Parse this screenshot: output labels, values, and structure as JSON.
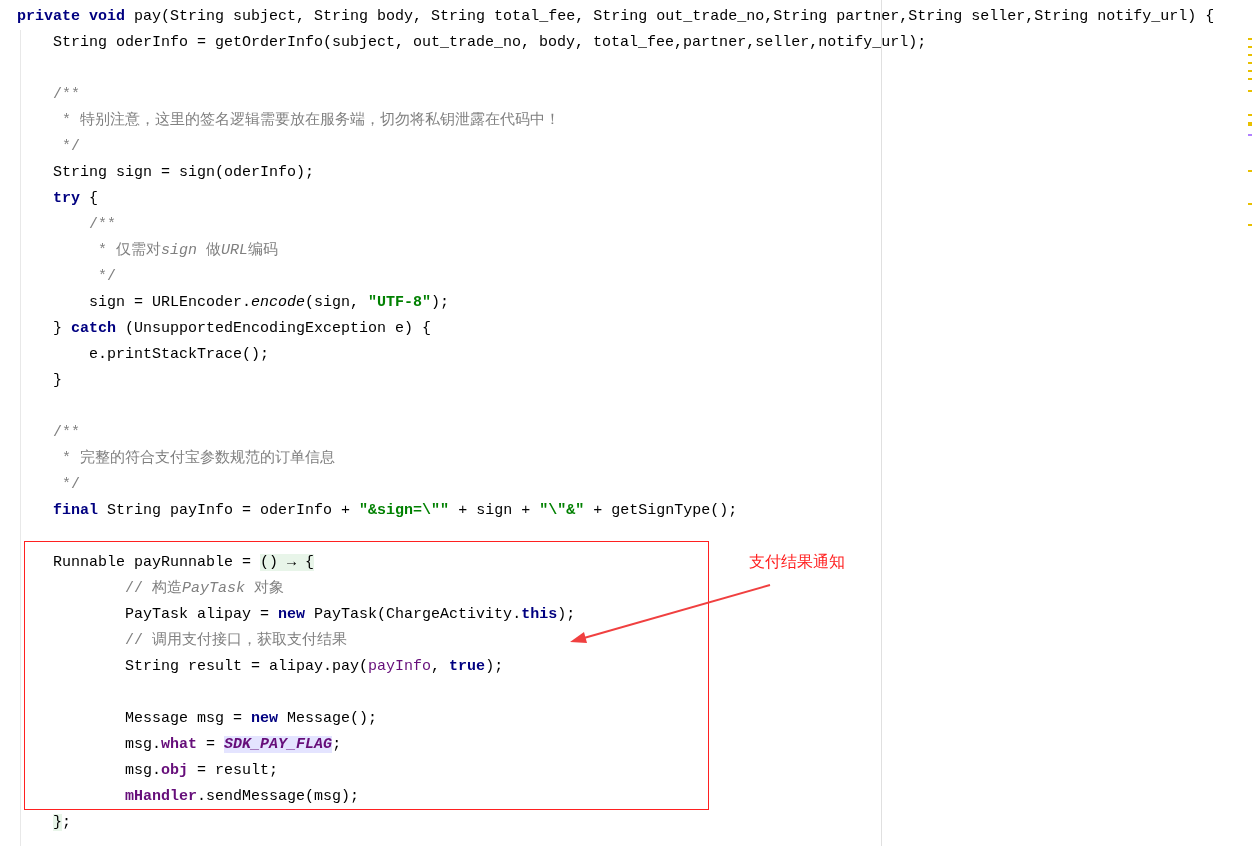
{
  "code_lines": [
    {
      "kind": "code",
      "tokens": [
        {
          "text": "private",
          "kind": "keyword"
        },
        {
          "text": " void",
          "kind": "keyword"
        },
        {
          "text": " pay(String subject, String body, String total_fee, String out_trade_no,String partner,String seller,String notify_url) {",
          "kind": "plain"
        }
      ]
    },
    {
      "kind": "code",
      "tokens": [
        {
          "text": "    String oderInfo = getOrderInfo(subject, out_trade_no, body, total_fee,partner,seller,notify_url);",
          "kind": "plain"
        }
      ]
    },
    {
      "kind": "blank"
    },
    {
      "kind": "code",
      "tokens": [
        {
          "text": "    /**",
          "kind": "comment"
        }
      ]
    },
    {
      "kind": "code",
      "tokens": [
        {
          "text": "     * 特别注意，这里的签名逻辑需要放在服务端，切勿将私钥泄露在代码中！",
          "kind": "comment"
        }
      ]
    },
    {
      "kind": "code",
      "tokens": [
        {
          "text": "     */",
          "kind": "comment"
        }
      ]
    },
    {
      "kind": "code",
      "tokens": [
        {
          "text": "    String sign = sign(oderInfo);",
          "kind": "plain"
        }
      ]
    },
    {
      "kind": "code",
      "tokens": [
        {
          "text": "    try",
          "kind": "keyword"
        },
        {
          "text": " {",
          "kind": "plain"
        }
      ]
    },
    {
      "kind": "code",
      "tokens": [
        {
          "text": "        /**",
          "kind": "comment"
        }
      ]
    },
    {
      "kind": "code",
      "tokens": [
        {
          "text": "         * 仅需对",
          "kind": "comment"
        },
        {
          "text": "sign",
          "kind": "comment_italic"
        },
        {
          "text": " 做",
          "kind": "comment"
        },
        {
          "text": "URL",
          "kind": "comment_italic"
        },
        {
          "text": "编码",
          "kind": "comment"
        }
      ]
    },
    {
      "kind": "code",
      "tokens": [
        {
          "text": "         */",
          "kind": "comment"
        }
      ]
    },
    {
      "kind": "code",
      "tokens": [
        {
          "text": "        sign = URLEncoder.",
          "kind": "plain"
        },
        {
          "text": "encode",
          "kind": "italic"
        },
        {
          "text": "(sign, ",
          "kind": "plain"
        },
        {
          "text": "\"UTF-8\"",
          "kind": "string"
        },
        {
          "text": ");",
          "kind": "plain"
        }
      ]
    },
    {
      "kind": "code",
      "tokens": [
        {
          "text": "    } ",
          "kind": "plain"
        },
        {
          "text": "catch",
          "kind": "keyword"
        },
        {
          "text": " (UnsupportedEncodingException e) {",
          "kind": "plain"
        }
      ]
    },
    {
      "kind": "code",
      "tokens": [
        {
          "text": "        e.printStackTrace();",
          "kind": "plain"
        }
      ]
    },
    {
      "kind": "code",
      "tokens": [
        {
          "text": "    }",
          "kind": "plain"
        }
      ]
    },
    {
      "kind": "blank"
    },
    {
      "kind": "code",
      "tokens": [
        {
          "text": "    /**",
          "kind": "comment"
        }
      ]
    },
    {
      "kind": "code",
      "tokens": [
        {
          "text": "     * 完整的符合支付宝参数规范的订单信息",
          "kind": "comment"
        }
      ]
    },
    {
      "kind": "code",
      "tokens": [
        {
          "text": "     */",
          "kind": "comment"
        }
      ]
    },
    {
      "kind": "code",
      "tokens": [
        {
          "text": "    final",
          "kind": "keyword"
        },
        {
          "text": " String payInfo = oderInfo + ",
          "kind": "plain"
        },
        {
          "text": "\"&sign=\\\"\"",
          "kind": "string"
        },
        {
          "text": " + sign + ",
          "kind": "plain"
        },
        {
          "text": "\"\\\"&\"",
          "kind": "string"
        },
        {
          "text": " + getSignType();",
          "kind": "plain"
        }
      ]
    },
    {
      "kind": "blank"
    },
    {
      "kind": "code",
      "tokens": [
        {
          "text": "    Runnable payRunnable = ",
          "kind": "plain"
        },
        {
          "text": "() → {",
          "kind": "lambda"
        }
      ]
    },
    {
      "kind": "code",
      "tokens": [
        {
          "text": "            // 构造",
          "kind": "comment"
        },
        {
          "text": "PayTask",
          "kind": "comment_italic"
        },
        {
          "text": " 对象",
          "kind": "comment"
        }
      ]
    },
    {
      "kind": "code",
      "tokens": [
        {
          "text": "            PayTask alipay = ",
          "kind": "plain"
        },
        {
          "text": "new",
          "kind": "keyword"
        },
        {
          "text": " PayTask(ChargeActivity.",
          "kind": "plain"
        },
        {
          "text": "this",
          "kind": "keyword"
        },
        {
          "text": ");",
          "kind": "plain"
        }
      ]
    },
    {
      "kind": "code",
      "tokens": [
        {
          "text": "            // 调用支付接口，获取支付结果",
          "kind": "comment"
        }
      ]
    },
    {
      "kind": "code",
      "tokens": [
        {
          "text": "            String result = alipay.pay(",
          "kind": "plain"
        },
        {
          "text": "payInfo",
          "kind": "param"
        },
        {
          "text": ", ",
          "kind": "plain"
        },
        {
          "text": "true",
          "kind": "keyword"
        },
        {
          "text": ");",
          "kind": "plain"
        }
      ]
    },
    {
      "kind": "blank"
    },
    {
      "kind": "code",
      "tokens": [
        {
          "text": "            Message msg = ",
          "kind": "plain"
        },
        {
          "text": "new",
          "kind": "keyword"
        },
        {
          "text": " Message();",
          "kind": "plain"
        }
      ]
    },
    {
      "kind": "code",
      "tokens": [
        {
          "text": "            msg.",
          "kind": "plain"
        },
        {
          "text": "what",
          "kind": "field"
        },
        {
          "text": " = ",
          "kind": "plain"
        },
        {
          "text": "SDK_PAY_FLAG",
          "kind": "constant"
        },
        {
          "text": ";",
          "kind": "plain"
        }
      ]
    },
    {
      "kind": "code",
      "tokens": [
        {
          "text": "            msg.",
          "kind": "plain"
        },
        {
          "text": "obj",
          "kind": "field"
        },
        {
          "text": " = result;",
          "kind": "plain"
        }
      ]
    },
    {
      "kind": "code",
      "tokens": [
        {
          "text": "            mHandler",
          "kind": "field"
        },
        {
          "text": ".sendMessage(msg);",
          "kind": "plain"
        }
      ]
    },
    {
      "kind": "code",
      "tokens": [
        {
          "text": "    }",
          "kind": "lambda"
        },
        {
          "text": ";",
          "kind": "plain"
        }
      ]
    }
  ],
  "annotation": {
    "label": "支付结果通知"
  }
}
